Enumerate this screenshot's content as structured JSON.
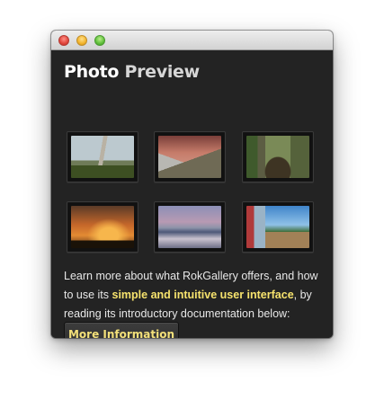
{
  "window": {
    "title_part1": "Photo",
    "title_part2": " Preview",
    "traffic_lights": [
      "close-button",
      "minimize-button",
      "zoom-button"
    ]
  },
  "gallery": {
    "thumbnails": [
      {
        "subject": "church on hillside with trees"
      },
      {
        "subject": "mountain slopes under pink sky"
      },
      {
        "subject": "large tree roots in forest"
      },
      {
        "subject": "orange sunset over horizon"
      },
      {
        "subject": "lake reflecting mountains at dusk"
      },
      {
        "subject": "wooden pier walkway by the sea"
      }
    ]
  },
  "description": {
    "text_before": "Learn more about what RokGallery offers, and how to use its ",
    "highlight": "simple and intuitive user interface",
    "text_after": ", by reading its introductory documentation below:"
  },
  "button": {
    "label": "More Information"
  },
  "colors": {
    "window_bg": "#232323",
    "highlight": "#f7e36d",
    "button_text": "#f3e07a"
  }
}
